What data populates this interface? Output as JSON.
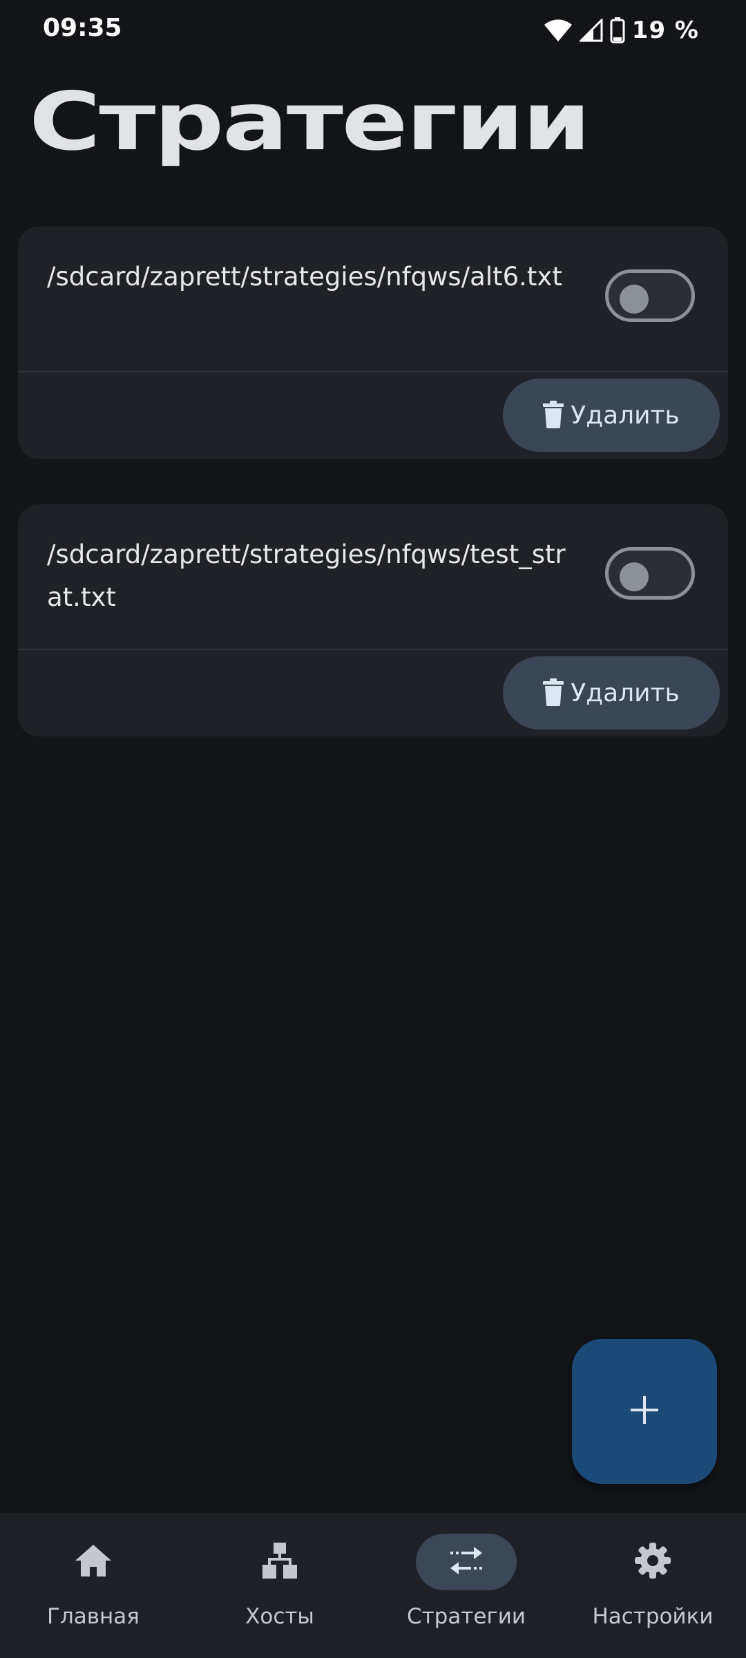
{
  "status_bar": {
    "time": "09:35",
    "battery": "19 %",
    "icons": [
      "wifi-icon",
      "cellular-signal-icon",
      "battery-icon"
    ]
  },
  "title": "Стратегии",
  "strategies": [
    {
      "path": "/sdcard/zaprett/strategies/nfqws/alt6.txt",
      "enabled": false,
      "delete_label": "Удалить"
    },
    {
      "path": "/sdcard/zaprett/strategies/nfqws/test_strat.txt",
      "enabled": false,
      "delete_label": "Удалить"
    }
  ],
  "fab": {
    "icon": "plus-icon"
  },
  "nav": [
    {
      "label": "Главная",
      "icon": "home-icon",
      "active": false
    },
    {
      "label": "Хосты",
      "icon": "hierarchy-icon",
      "active": false
    },
    {
      "label": "Стратегии",
      "icon": "swap-arrows-icon",
      "active": true
    },
    {
      "label": "Настройки",
      "icon": "gear-icon",
      "active": false
    }
  ],
  "colors": {
    "background": "#121418",
    "card": "#1f2126",
    "accent_fab": "#1c4a78",
    "button": "#3a4556",
    "nav_active": "#3b4656"
  }
}
